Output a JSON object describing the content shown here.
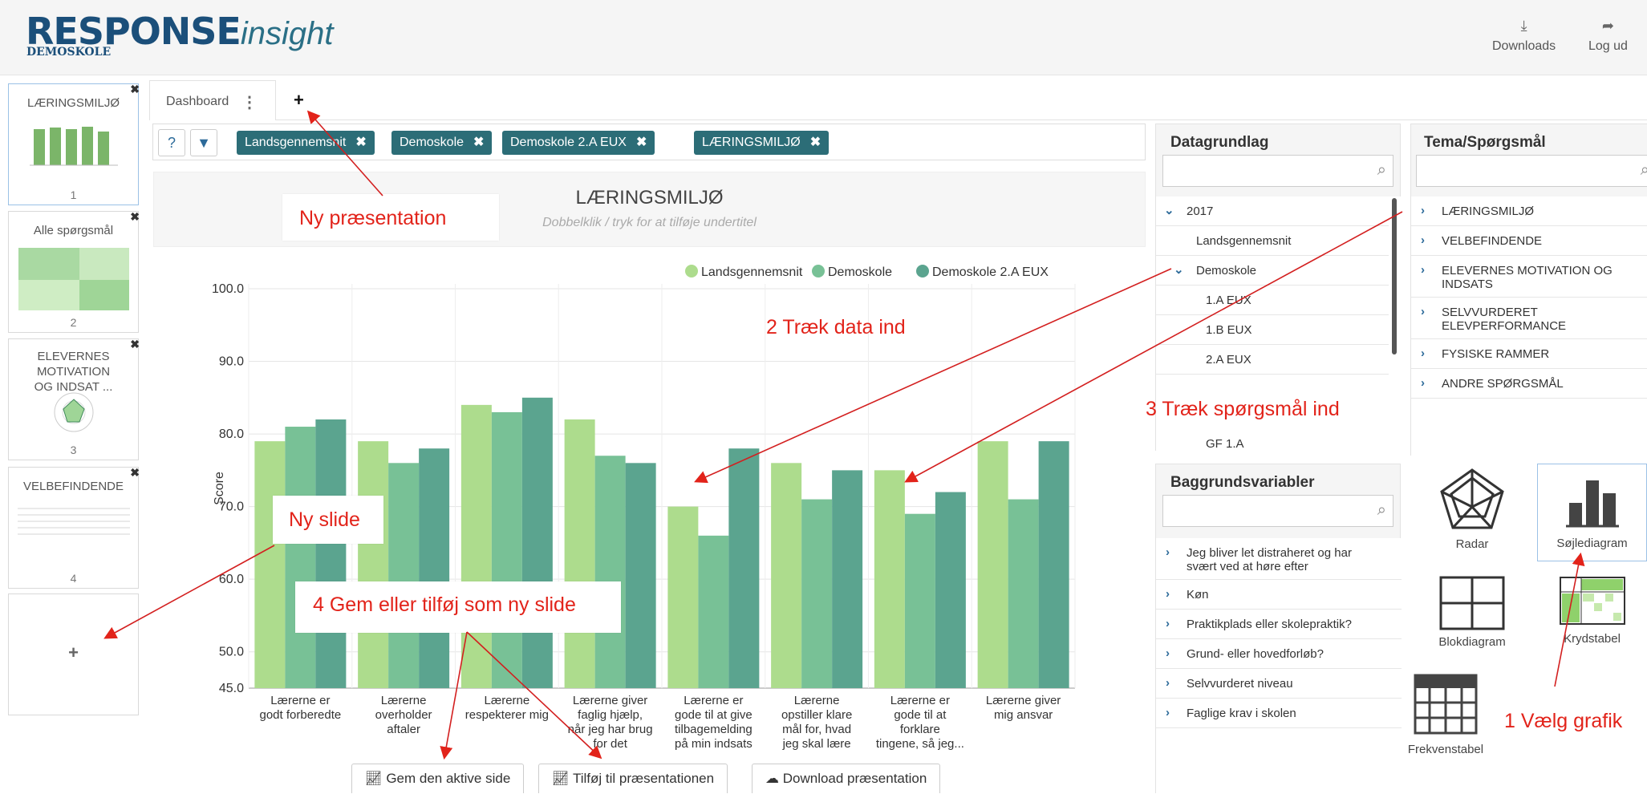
{
  "header": {
    "logo_main": "RESPONSE",
    "logo_insight": "insight",
    "logo_sub": "DEMOSKOLE",
    "downloads_label": "Downloads",
    "logout_label": "Log ud"
  },
  "slides": [
    {
      "title": "LÆRINGSMILJØ",
      "number": "1"
    },
    {
      "title": "Alle spørgsmål",
      "number": "2"
    },
    {
      "title": "ELEVERNES MOTIVATION OG INDSAT ...",
      "number": "3"
    },
    {
      "title": "VELBEFINDENDE",
      "number": "4"
    }
  ],
  "add_slide_label": "+",
  "tabs": {
    "dashboard": "Dashboard",
    "menu": "⋮",
    "add": "+"
  },
  "filters": [
    "Landsgennemsnit",
    "Demoskole",
    "Demoskole 2.A EUX",
    "LÆRINGSMILJØ"
  ],
  "presentation": {
    "title": "LÆRINGSMILJØ",
    "subtitle": "Dobbelklik / tryk for at tilføje undertitel"
  },
  "chart_data": {
    "type": "bar",
    "ylabel": "Score",
    "ylim": [
      45,
      100
    ],
    "yticks": [
      "100.0",
      "90.0",
      "80.0",
      "70.0",
      "60.0",
      "50.0",
      "45.0"
    ],
    "legend_position": "top-right",
    "categories": [
      [
        "Lærerne er",
        "godt forberedte"
      ],
      [
        "Lærerne",
        "overholder",
        "aftaler"
      ],
      [
        "Lærerne",
        "respekterer mig"
      ],
      [
        "Lærerne giver",
        "faglig hjælp,",
        "når jeg har brug",
        "for det"
      ],
      [
        "Lærerne er",
        "gode til at give",
        "tilbagemelding",
        "på min indsats"
      ],
      [
        "Lærerne",
        "opstiller klare",
        "mål for, hvad",
        "jeg skal lære"
      ],
      [
        "Lærerne er",
        "gode til at",
        "forklare",
        "tingene, så jeg..."
      ],
      [
        "Lærerne giver",
        "mig ansvar"
      ]
    ],
    "series": [
      {
        "name": "Landsgennemsnit",
        "color": "#addc8d",
        "values": [
          79,
          79,
          84,
          82,
          70,
          76,
          75,
          79
        ]
      },
      {
        "name": "Demoskole",
        "color": "#78c196",
        "values": [
          81,
          76,
          83,
          77,
          66,
          71,
          69,
          71
        ]
      },
      {
        "name": "Demoskole 2.A EUX",
        "color": "#5ba48f",
        "values": [
          82,
          78,
          85,
          76,
          78,
          75,
          72,
          79
        ]
      }
    ]
  },
  "actions": {
    "save": "Gem den aktive side",
    "add": "Tilføj til præsentationen",
    "download": "Download præsentation"
  },
  "datagrundlag": {
    "title": "Datagrundlag",
    "items": [
      {
        "label": "2017",
        "expanded": true
      },
      {
        "label": "Landsgennemsnit"
      },
      {
        "label": "Demoskole",
        "expanded": true
      },
      {
        "label": "1.A EUX"
      },
      {
        "label": "1.B EUX"
      },
      {
        "label": "2.A EUX"
      },
      {
        "label": "GF 1.A"
      }
    ]
  },
  "tema": {
    "title": "Tema/Spørgsmål",
    "items": [
      "LÆRINGSMILJØ",
      "VELBEFINDENDE",
      "ELEVERNES MOTIVATION OG INDSATS",
      "SELVVURDERET ELEVPERFORMANCE",
      "FYSISKE RAMMER",
      "ANDRE SPØRGSMÅL"
    ]
  },
  "baggrund": {
    "title": "Baggrundsvariabler",
    "items": [
      "Jeg bliver let distraheret og har svært ved at høre efter",
      "Køn",
      "Praktikplads eller skolepraktik?",
      "Grund- eller hovedforløb?",
      "Selvvurderet niveau",
      "Faglige krav i skolen"
    ]
  },
  "graphics": {
    "radar": "Radar",
    "bar": "Søjlediagram",
    "block": "Blokdiagram",
    "cross": "Krydstabel",
    "freq": "Frekvenstabel"
  },
  "annotations": {
    "ny_praesentation": "Ny præsentation",
    "ny_slide": "Ny slide",
    "traek_data": "2 Træk data ind",
    "traek_spm": "3 Træk spørgsmål ind",
    "gem": "4 Gem eller tilføj som ny slide",
    "vaelg": "1 Vælg grafik"
  },
  "colors": {
    "brand": "#1b4f7a",
    "chip": "#2c6d77",
    "annotation": "#e2231a"
  }
}
